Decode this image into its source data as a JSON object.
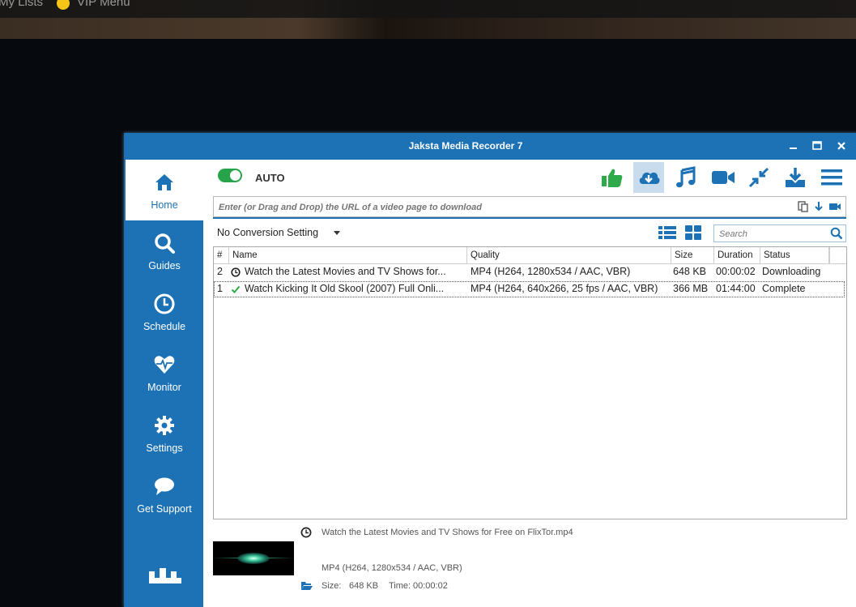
{
  "background_site": {
    "nav": [
      "My Lists",
      "VIP Menu"
    ]
  },
  "window": {
    "title": "Jaksta Media Recorder 7",
    "controls": [
      "minimize",
      "maximize",
      "close"
    ]
  },
  "sidebar": {
    "items": [
      {
        "label": "Home",
        "icon": "home-icon",
        "active": true
      },
      {
        "label": "Guides",
        "icon": "search-icon"
      },
      {
        "label": "Schedule",
        "icon": "clock-icon"
      },
      {
        "label": "Monitor",
        "icon": "heart-pulse-icon"
      },
      {
        "label": "Settings",
        "icon": "gear-icon"
      },
      {
        "label": "Get Support",
        "icon": "chat-bubble-icon"
      }
    ]
  },
  "toolbar": {
    "auto_label": "AUTO",
    "auto_on": true,
    "tools": [
      "thumbs-up-icon",
      "cloud-download-icon",
      "music-icon",
      "video-camera-icon",
      "compress-icon",
      "download-tray-icon",
      "menu-icon"
    ],
    "selected_tool": "cloud-download-icon"
  },
  "url": {
    "placeholder": "Enter (or Drag and Drop) the URL of a video page to download"
  },
  "conversion": {
    "value": "No Conversion Setting"
  },
  "search": {
    "placeholder": "Search"
  },
  "table": {
    "columns": [
      "#",
      "Name",
      "Quality",
      "Size",
      "Duration",
      "Status"
    ],
    "rows": [
      {
        "num": "2",
        "status_icon": "clock-icon",
        "name": "Watch the Latest Movies and TV Shows for...",
        "quality": "MP4 (H264, 1280x534 / AAC, VBR)",
        "size": "648 KB",
        "duration": "00:00:02",
        "status": "Downloading"
      },
      {
        "num": "1",
        "status_icon": "check-icon",
        "name": "Watch Kicking It Old Skool (2007) Full Onli...",
        "quality": "MP4 (H264, 640x266, 25 fps / AAC, VBR)",
        "size": "366 MB",
        "duration": "01:44:00",
        "status": "Complete"
      }
    ]
  },
  "details": {
    "filename": "Watch the Latest Movies and TV Shows for Free on FlixTor.mp4",
    "format": "MP4 (H264, 1280x534 / AAC, VBR)",
    "size_label": "Size:",
    "size": "648 KB",
    "time_label": "Time:",
    "time": "00:00:02"
  },
  "colors": {
    "brand": "#1d72b5",
    "toggle_on": "#27a34a",
    "thumbs": "#2eaa4a"
  }
}
